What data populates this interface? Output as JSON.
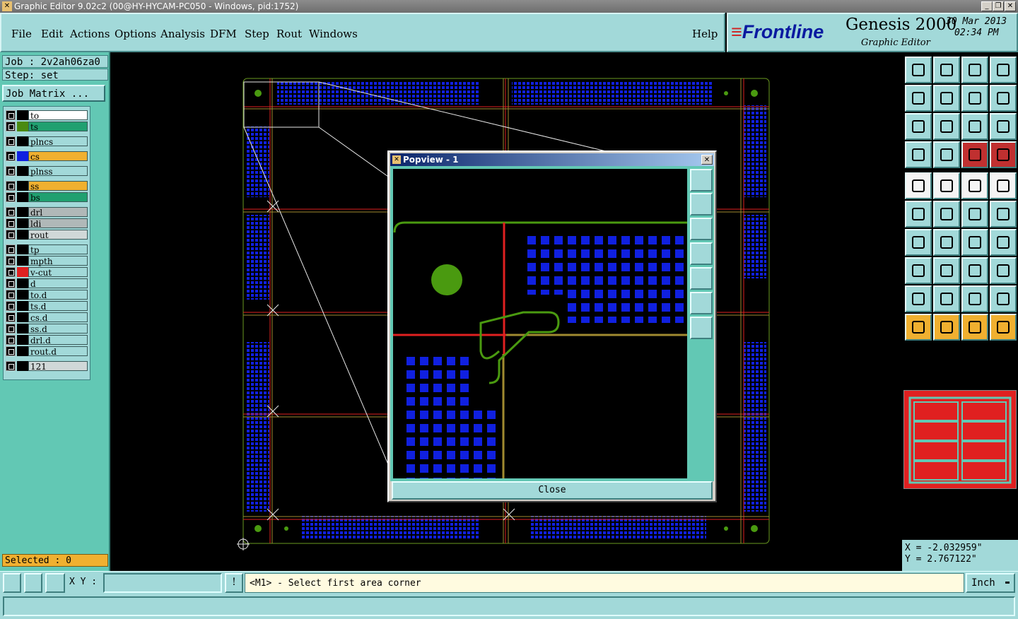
{
  "window": {
    "title": "Graphic Editor 9.02c2 (00@HY-HYCAM-PC050 - Windows, pid:1752)"
  },
  "menu": [
    "File",
    "Edit",
    "Actions",
    "Options",
    "Analysis",
    "DFM",
    "Step",
    "Rout",
    "Windows"
  ],
  "help": "Help",
  "brand": {
    "logo": "Frontline",
    "product": "Genesis 2000",
    "subtitle": "Graphic Editor",
    "date": "30 Mar 2013",
    "time": "02:34 PM"
  },
  "job": {
    "job": "Job : 2v2ah06za0",
    "step": "Step: set",
    "matrix": "Job Matrix ..."
  },
  "layers": [
    {
      "name": "to",
      "color": "#ffffff",
      "swatch": "#000000"
    },
    {
      "name": "ts",
      "color": "#20a070",
      "swatch": "#4a8a10"
    },
    {
      "name": "plncs",
      "color": "#a2d9d9",
      "swatch": "#000000"
    },
    {
      "name": "cs",
      "color": "#f0b030",
      "swatch": "#1020e0"
    },
    {
      "name": "plnss",
      "color": "#a2d9d9",
      "swatch": "#000000"
    },
    {
      "name": "ss",
      "color": "#f0b030",
      "swatch": "#000000"
    },
    {
      "name": "bs",
      "color": "#20a070",
      "swatch": "#000000"
    },
    {
      "name": "drl",
      "color": "#b0b8b8",
      "swatch": "#000000"
    },
    {
      "name": "ldi",
      "color": "#b0b8b8",
      "swatch": "#000000"
    },
    {
      "name": "rout",
      "color": "#d0d8d8",
      "swatch": "#000000"
    },
    {
      "name": "tp",
      "color": "#a2d9d9",
      "swatch": "#000000"
    },
    {
      "name": "mpth",
      "color": "#a2d9d9",
      "swatch": "#000000"
    },
    {
      "name": "v-cut",
      "color": "#a2d9d9",
      "swatch": "#e02020"
    },
    {
      "name": "d",
      "color": "#a2d9d9",
      "swatch": "#000000"
    },
    {
      "name": "to.d",
      "color": "#a2d9d9",
      "swatch": "#000000"
    },
    {
      "name": "ts.d",
      "color": "#a2d9d9",
      "swatch": "#000000"
    },
    {
      "name": "cs.d",
      "color": "#a2d9d9",
      "swatch": "#000000"
    },
    {
      "name": "ss.d",
      "color": "#a2d9d9",
      "swatch": "#000000"
    },
    {
      "name": "drl.d",
      "color": "#a2d9d9",
      "swatch": "#000000"
    },
    {
      "name": "rout.d",
      "color": "#a2d9d9",
      "swatch": "#000000"
    },
    {
      "name": "121",
      "color": "#d0d8d8",
      "swatch": "#000000"
    }
  ],
  "selected": "Selected : 0",
  "popview": {
    "title": "Popview - 1",
    "close": "Close"
  },
  "coords": {
    "x": "X = -2.032959\"",
    "y": "Y = 2.767122\""
  },
  "status": {
    "xy_label": "X Y :",
    "xy_value": "",
    "prompt": "<M1> - Select first area corner",
    "units": "Inch"
  },
  "colors": {
    "panel": "#a2d9d9",
    "accent": "#62c8b4",
    "pad": "#1020e0",
    "vcut": "#e02020"
  }
}
